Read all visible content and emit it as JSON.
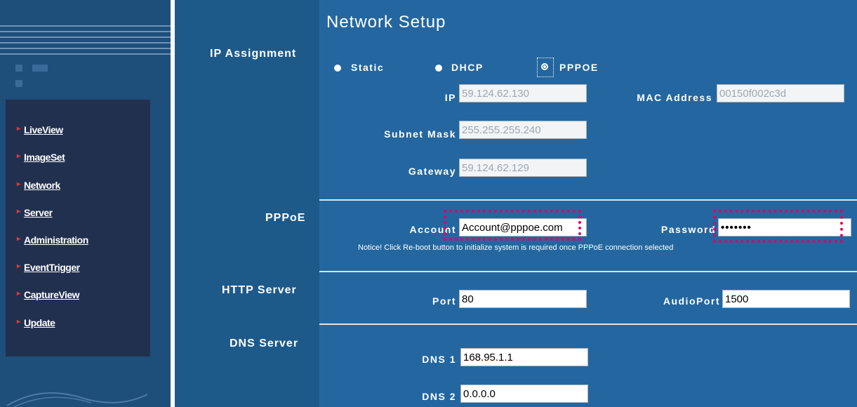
{
  "nav": {
    "items": [
      "LiveView",
      "ImageSet",
      "Network",
      "Server",
      "Administration",
      "EventTrigger",
      "CaptureView",
      "Update"
    ]
  },
  "page": {
    "title": "Network Setup"
  },
  "sections": {
    "ip_assignment": "IP Assignment",
    "pppoe": "PPPoE",
    "http_server": "HTTP Server",
    "dns_server": "DNS Server"
  },
  "ip_assignment": {
    "options": [
      "Static",
      "DHCP",
      "PPPOE"
    ],
    "selected": "PPPOE"
  },
  "fields": {
    "ip": {
      "label": "IP",
      "value": "59.124.62.130"
    },
    "mac": {
      "label": "MAC Address",
      "value": "00150f002c3d"
    },
    "subnet": {
      "label": "Subnet Mask",
      "value": "255.255.255.240"
    },
    "gateway": {
      "label": "Gateway",
      "value": "59.124.62.129"
    },
    "account": {
      "label": "Account",
      "value": "Account@pppoe.com"
    },
    "password": {
      "label": "Password",
      "value": "•••••••"
    },
    "port": {
      "label": "Port",
      "value": "80"
    },
    "audio_port": {
      "label": "AudioPort",
      "value": "1500"
    },
    "dns1": {
      "label": "DNS 1",
      "value": "168.95.1.1"
    },
    "dns2": {
      "label": "DNS 2",
      "value": "0.0.0.0"
    }
  },
  "notice": "Notice! Click Re-boot button to initialize system is required once PPPoE connection selected",
  "colors": {
    "sidebar_bg": "#1e4e7a",
    "nav_panel_bg": "#22304f",
    "label_column_bg": "#1d5a8a",
    "content_bg": "#2467a0",
    "highlight": "#e0006a",
    "bullet": "#d83a3a"
  }
}
